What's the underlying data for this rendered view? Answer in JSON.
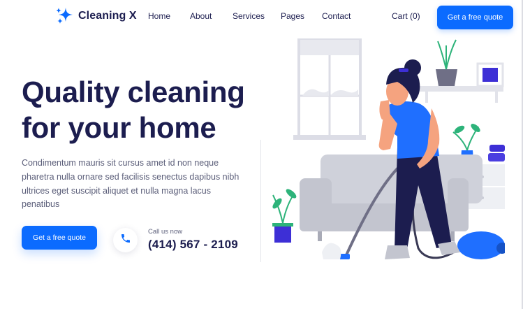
{
  "brand": {
    "name": "Cleaning X",
    "icon": "sparkle-icon",
    "accent_color": "#0b6bff",
    "text_color": "#1c1d4f"
  },
  "nav": {
    "items": [
      {
        "label": "Home"
      },
      {
        "label": "About"
      },
      {
        "label": "Services"
      },
      {
        "label": "Pages"
      },
      {
        "label": "Contact"
      }
    ]
  },
  "header": {
    "cart_label": "Cart (0)",
    "cta_label": "Get a free quote"
  },
  "hero": {
    "title_line1": "Quality cleaning",
    "title_line2": "for your home",
    "description": "Condimentum mauris sit cursus amet id non neque pharetra nulla ornare sed facilisis senectus dapibus nibh ultrices eget suscipit aliquet et nulla magna lacus penatibus",
    "cta_label": "Get a free quote",
    "call_label": "Call us now",
    "phone_number": "(414) 567 - 2109",
    "phone_icon": "phone-icon",
    "illustration": "woman-vacuuming-illustration"
  }
}
